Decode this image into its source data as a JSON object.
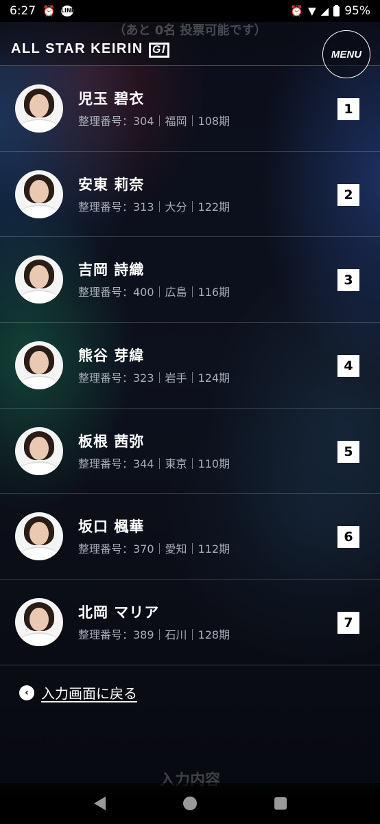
{
  "status": {
    "time": "6:27",
    "battery": "95%"
  },
  "header": {
    "ghost_text": "（あと 0名 投票可能です）",
    "logo": "ALL STAR KEIRIN",
    "logo_badge": "GI",
    "menu_label": "MENU"
  },
  "riders": [
    {
      "name": "児玉 碧衣",
      "meta": "整理番号：304｜福岡｜108期",
      "rank": "1"
    },
    {
      "name": "安東 莉奈",
      "meta": "整理番号：313｜大分｜122期",
      "rank": "2"
    },
    {
      "name": "吉岡 詩織",
      "meta": "整理番号：400｜広島｜116期",
      "rank": "3"
    },
    {
      "name": "熊谷 芽緯",
      "meta": "整理番号：323｜岩手｜124期",
      "rank": "4"
    },
    {
      "name": "板根 茜弥",
      "meta": "整理番号：344｜東京｜110期",
      "rank": "5"
    },
    {
      "name": "坂口 楓華",
      "meta": "整理番号：370｜愛知｜112期",
      "rank": "6"
    },
    {
      "name": "北岡 マリア",
      "meta": "整理番号：389｜石川｜128期",
      "rank": "7"
    }
  ],
  "back_link": "入力画面に戻る",
  "ghost_bottom": "入力内容"
}
